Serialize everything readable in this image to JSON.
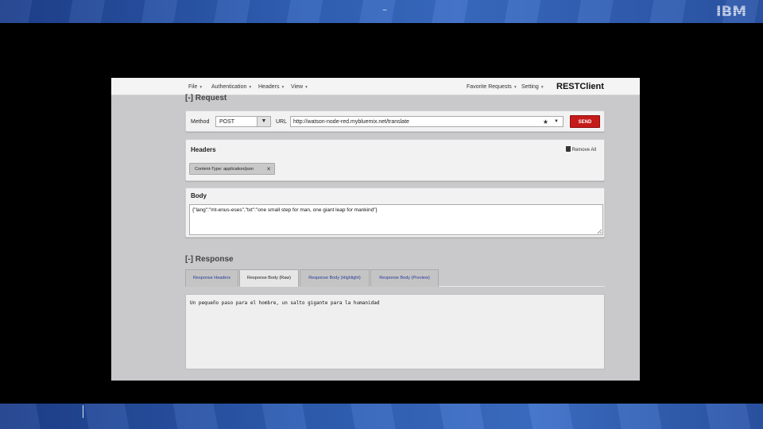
{
  "slide": {
    "top_mark": "~",
    "logo_text": "IBM",
    "colors": {
      "band": "#2f5fb5",
      "send": "#c51a1a"
    }
  },
  "menubar": {
    "items": [
      {
        "label": "File",
        "icon": "caret-down-icon"
      },
      {
        "label": "Authentication",
        "icon": "caret-down-icon"
      },
      {
        "label": "Headers",
        "icon": "caret-down-icon"
      },
      {
        "label": "View",
        "icon": "caret-down-icon"
      }
    ],
    "right_items": [
      {
        "label": "Favorite Requests",
        "icon": "caret-down-icon"
      },
      {
        "label": "Setting",
        "icon": "caret-down-icon"
      }
    ],
    "brand": "RESTClient"
  },
  "request": {
    "section_title": "[-] Request",
    "method_label": "Method",
    "method_value": "POST",
    "url_label": "URL",
    "url_value": "http://watson-node-red.mybluemix.net/translate",
    "send_label": "SEND"
  },
  "headers": {
    "title": "Headers",
    "remove_all_label": "Remove All",
    "chips": [
      {
        "label": "Content-Type: application/json"
      }
    ]
  },
  "body": {
    "title": "Body",
    "value": "{\"lang\":\"mt-enus-eses\",\"txt\":\"one small step for man, one giant leap for mankind\"}"
  },
  "response": {
    "section_title": "[-] Response",
    "tabs": [
      {
        "label": "Response Headers",
        "active": false
      },
      {
        "label": "Response Body (Raw)",
        "active": true
      },
      {
        "label": "Response Body (Highlight)",
        "active": false
      },
      {
        "label": "Response Body (Preview)",
        "active": false
      }
    ],
    "body_value": "Un pequeño paso para el hombre, un salto gigante para la humanidad"
  }
}
